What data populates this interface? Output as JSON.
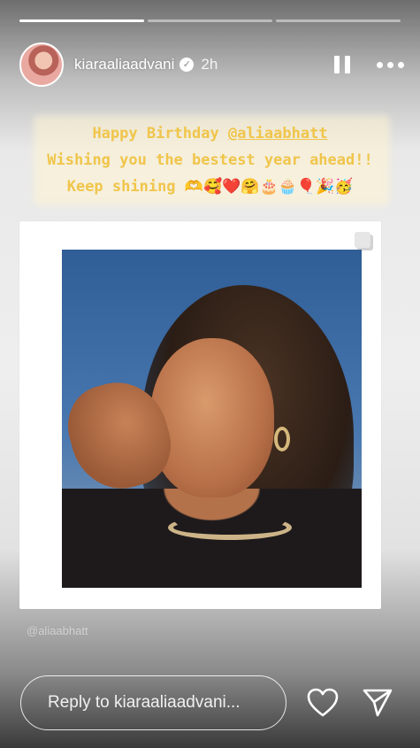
{
  "story": {
    "progress": [
      1.0,
      0.0,
      0.0
    ]
  },
  "header": {
    "username": "kiaraaliaadvani",
    "time": "2h",
    "verified": true
  },
  "caption": {
    "line1_text": "Happy Birthday ",
    "line1_mention": "@aliaabhatt",
    "line2": "Wishing you the bestest year ahead!!",
    "line3": "Keep shining 🫶🥰❤️🤗🎂🧁🎈🎉🥳"
  },
  "post": {
    "tag": "@aliaabhatt"
  },
  "footer": {
    "reply_placeholder": "Reply to kiaraaliaadvani..."
  },
  "icons": {
    "pause": "pause-icon",
    "more": "more-icon",
    "like": "heart-icon",
    "share": "send-icon",
    "multi": "multiple-posts-icon"
  }
}
